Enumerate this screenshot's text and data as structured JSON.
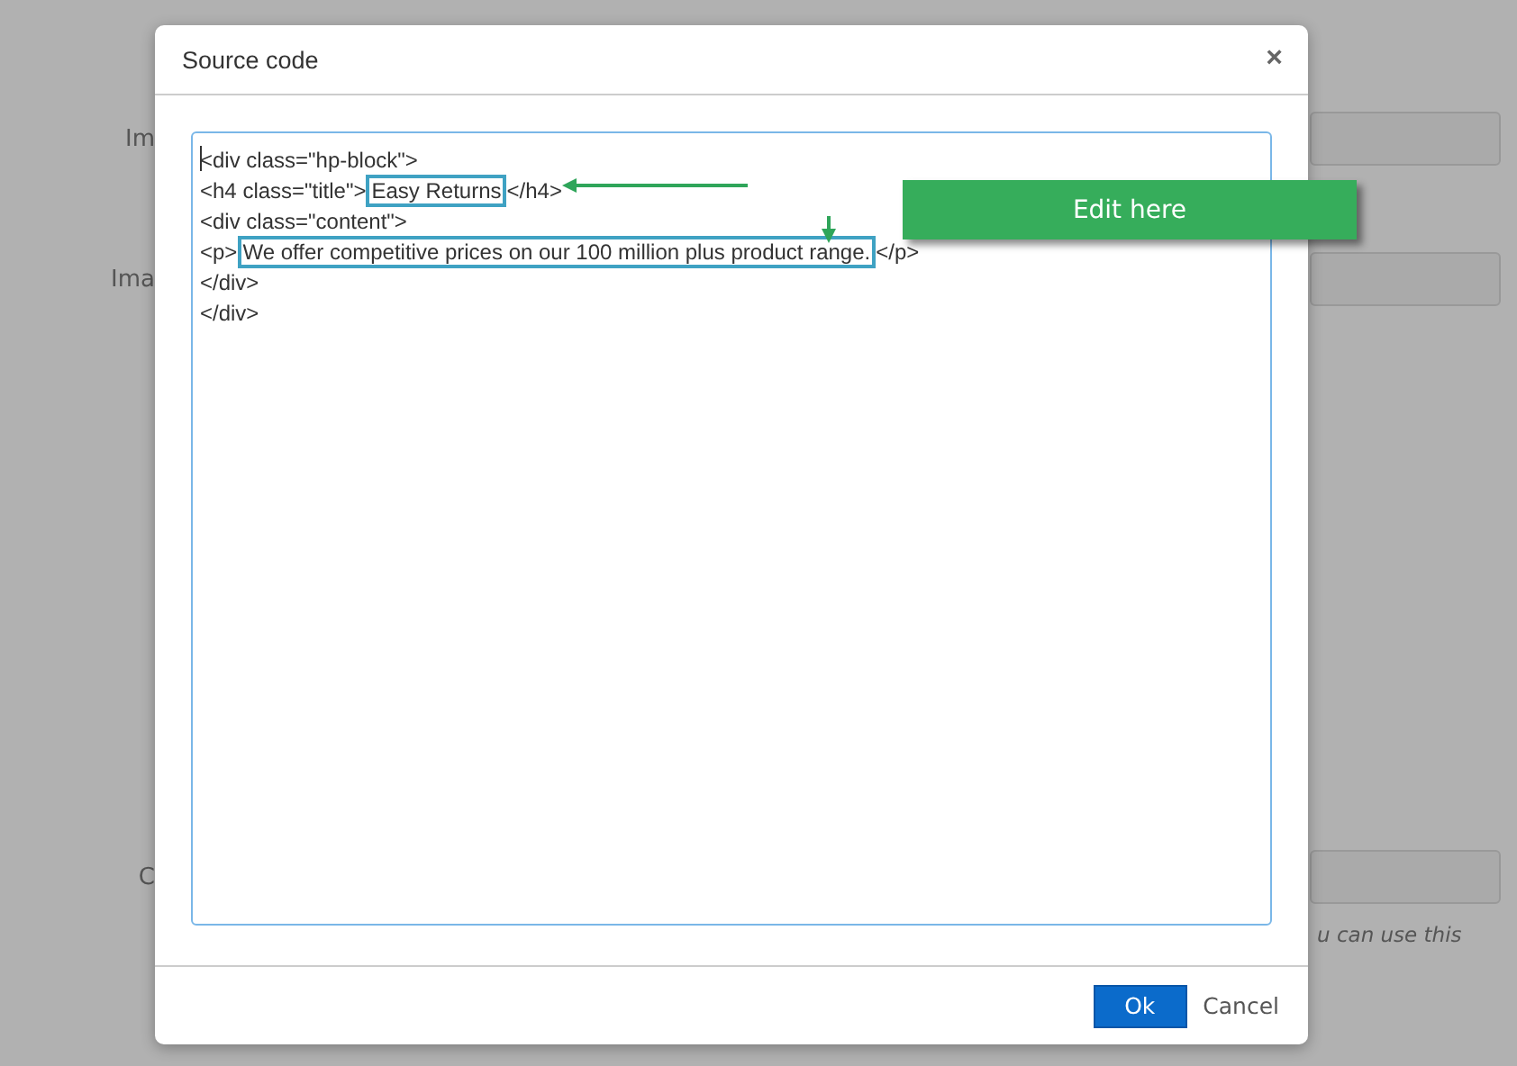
{
  "background": {
    "rows": [
      {
        "label": "Im"
      },
      {
        "label": "Ima"
      },
      {
        "label": "C",
        "hint": "u can use this"
      }
    ]
  },
  "dialog": {
    "title": "Source code",
    "close": "×",
    "code_lines": [
      {
        "segments": [
          {
            "text": "<div class=\"hp-block\">",
            "highlighted": false
          }
        ]
      },
      {
        "segments": [
          {
            "text": "<h4 class=\"title\">",
            "highlighted": false
          },
          {
            "text": "Easy Returns",
            "highlighted": true
          },
          {
            "text": "</h4>",
            "highlighted": false
          }
        ]
      },
      {
        "segments": [
          {
            "text": "<div class=\"content\">",
            "highlighted": false
          }
        ]
      },
      {
        "segments": [
          {
            "text": "<p>",
            "highlighted": false
          },
          {
            "text": "We offer competitive prices on our 100 million plus product range.",
            "highlighted": true
          },
          {
            "text": "</p>",
            "highlighted": false
          }
        ]
      },
      {
        "segments": [
          {
            "text": "</div>",
            "highlighted": false
          }
        ]
      },
      {
        "segments": [
          {
            "text": "</div>",
            "highlighted": false
          }
        ]
      }
    ],
    "callout": "Edit here",
    "buttons": [
      {
        "label": "Ok",
        "kind": "primary"
      },
      {
        "label": "Cancel",
        "kind": "link"
      }
    ]
  }
}
